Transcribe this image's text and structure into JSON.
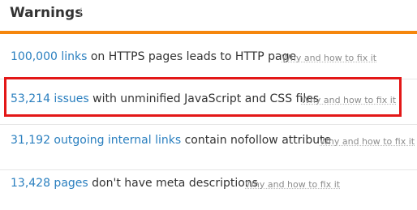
{
  "panel": {
    "title": "Warnings",
    "info_icon": "i"
  },
  "warnings": [
    {
      "count_link": "100,000 links",
      "text": "on HTTPS pages leads to HTTP page",
      "fix_link": "Why and how to fix it"
    },
    {
      "count_link": "53,214 issues",
      "text": "with unminified JavaScript and CSS files",
      "fix_link": "Why and how to fix it"
    },
    {
      "count_link": "31,192 outgoing internal links",
      "text": "contain nofollow attribute",
      "fix_link": "Why and how to fix it"
    },
    {
      "count_link": "13,428 pages",
      "text": "don't have meta descriptions",
      "fix_link": "Why and how to fix it"
    }
  ],
  "colors": {
    "accent": "#f5860d",
    "link": "#2a7fbf",
    "highlight": "#e31717"
  }
}
